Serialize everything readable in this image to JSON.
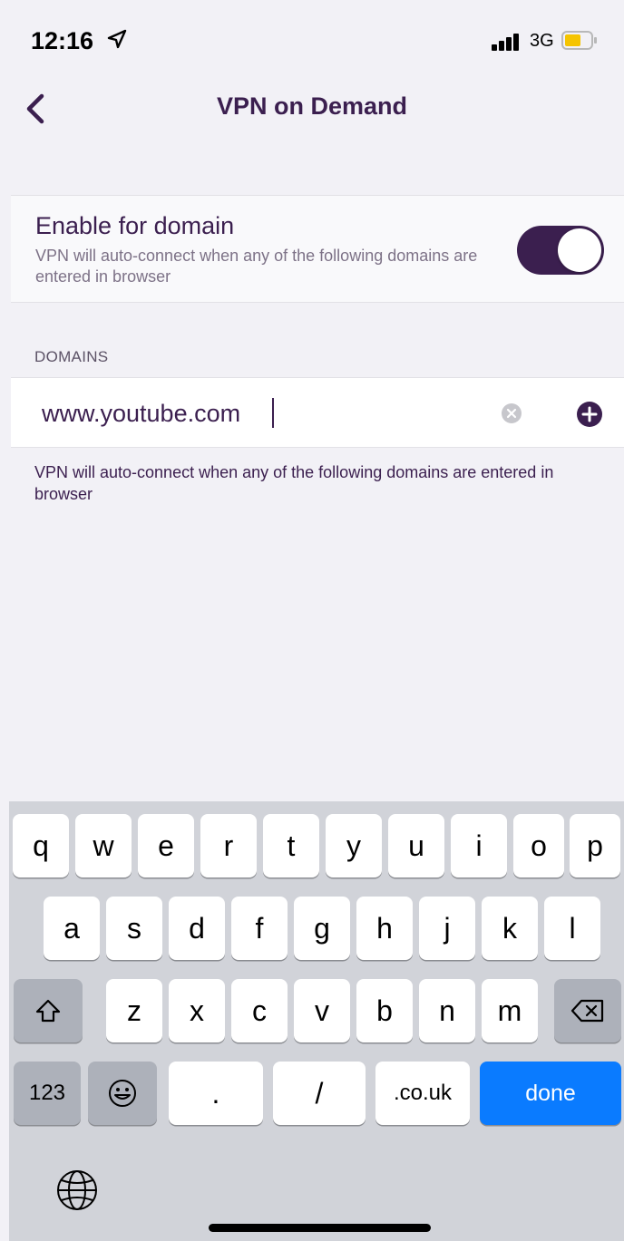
{
  "status_bar": {
    "time": "12:16",
    "network": "3G",
    "icons": [
      "location-arrow-icon",
      "signal-bars-icon",
      "battery-icon"
    ]
  },
  "nav": {
    "title": "VPN on Demand",
    "back_icon": "chevron-left-icon"
  },
  "enable_row": {
    "title": "Enable for domain",
    "description": "VPN will auto-connect when any of the following domains are entered in browser",
    "toggle_on": true
  },
  "domains": {
    "header": "DOMAINS",
    "input_value": "www.youtube.com",
    "clear_icon": "clear-circle-icon",
    "add_icon": "add-circle-icon",
    "footer": "VPN will auto-connect when any of the following domains are entered in browser"
  },
  "keyboard": {
    "row1": [
      "q",
      "w",
      "e",
      "r",
      "t",
      "y",
      "u",
      "i",
      "o",
      "p"
    ],
    "row2": [
      "a",
      "s",
      "d",
      "f",
      "g",
      "h",
      "j",
      "k",
      "l"
    ],
    "row3": [
      "z",
      "x",
      "c",
      "v",
      "b",
      "n",
      "m"
    ],
    "numbers_label": "123",
    "dot_label": ".",
    "slash_label": "/",
    "domain_label": ".co.uk",
    "done_label": "done"
  },
  "colors": {
    "accent": "#3b1f4f",
    "done_key": "#0a7bff",
    "battery": "#f5c400"
  }
}
